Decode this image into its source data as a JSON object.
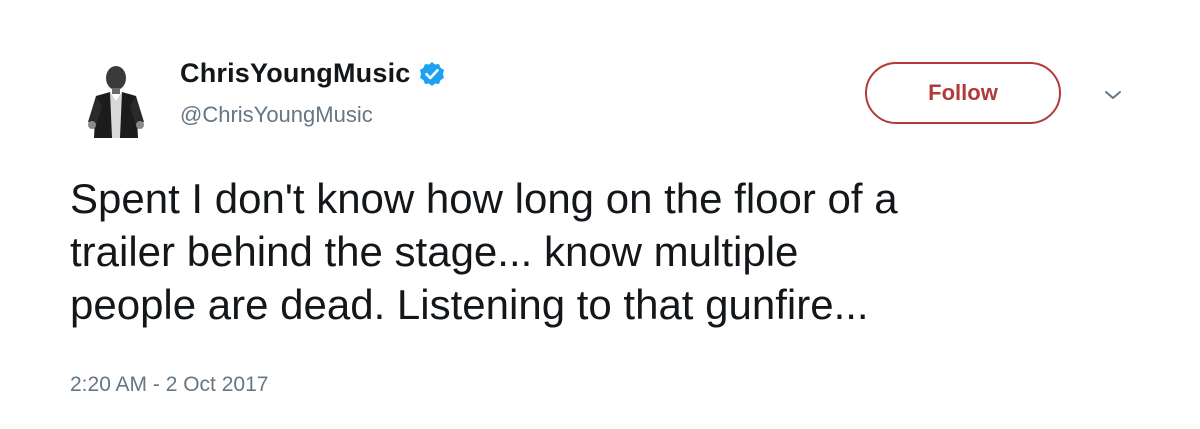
{
  "user": {
    "display_name": "ChrisYoungMusic",
    "handle": "@ChrisYoungMusic",
    "verified": true,
    "avatar_icon": "profile-photo-person-icon",
    "verified_icon": "verified-badge-icon"
  },
  "actions": {
    "follow_label": "Follow",
    "menu_icon": "chevron-down-icon"
  },
  "tweet": {
    "text": "Spent I don't know how long on the floor of a\ntrailer behind the stage... know multiple\npeople are dead. Listening to that gunfire...",
    "timestamp": "2:20 AM - 2 Oct 2017"
  },
  "colors": {
    "follow_accent": "#b23a3a",
    "verified_blue": "#1da1f2",
    "secondary_text": "#657786",
    "primary_text": "#14171a"
  }
}
